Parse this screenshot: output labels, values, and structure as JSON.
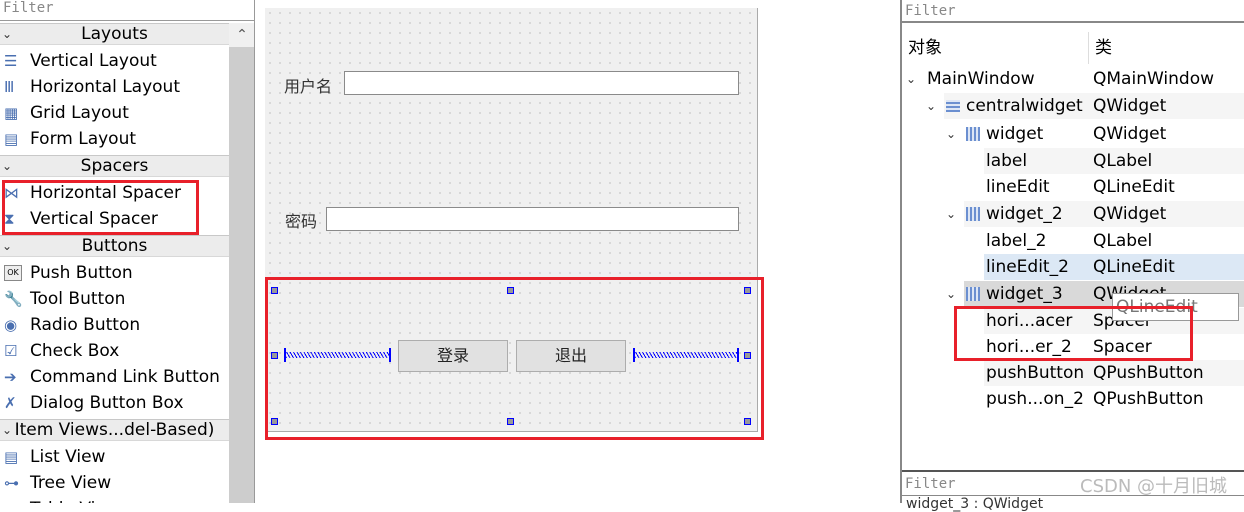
{
  "widget_box": {
    "filter_placeholder": "Filter",
    "categories": [
      {
        "label": "Layouts",
        "items": [
          {
            "label": "Vertical Layout",
            "icon": "vertical-layout-icon"
          },
          {
            "label": "Horizontal Layout",
            "icon": "horizontal-layout-icon"
          },
          {
            "label": "Grid Layout",
            "icon": "grid-layout-icon"
          },
          {
            "label": "Form Layout",
            "icon": "form-layout-icon"
          }
        ]
      },
      {
        "label": "Spacers",
        "items": [
          {
            "label": "Horizontal Spacer",
            "icon": "horizontal-spacer-icon"
          },
          {
            "label": "Vertical Spacer",
            "icon": "vertical-spacer-icon"
          }
        ]
      },
      {
        "label": "Buttons",
        "items": [
          {
            "label": "Push Button",
            "icon": "push-button-icon"
          },
          {
            "label": "Tool Button",
            "icon": "tool-button-icon"
          },
          {
            "label": "Radio Button",
            "icon": "radio-button-icon"
          },
          {
            "label": "Check Box",
            "icon": "check-box-icon"
          },
          {
            "label": "Command Link Button",
            "icon": "command-link-icon"
          },
          {
            "label": "Dialog Button Box",
            "icon": "dialog-button-box-icon"
          }
        ]
      },
      {
        "label": "Item Views...del-Based)",
        "items": [
          {
            "label": "List View",
            "icon": "list-view-icon"
          },
          {
            "label": "Tree View",
            "icon": "tree-view-icon"
          },
          {
            "label": "Table View",
            "icon": "table-view-icon"
          }
        ]
      }
    ]
  },
  "form": {
    "username_label": "用户名",
    "password_label": "密码",
    "login_button": "登录",
    "quit_button": "退出"
  },
  "object_inspector": {
    "filter_placeholder": "Filter",
    "col_object": "对象",
    "col_class": "类",
    "rows": [
      {
        "name": "MainWindow",
        "class": "QMainWindow"
      },
      {
        "name": "centralwidget",
        "class": "QWidget"
      },
      {
        "name": "widget",
        "class": "QWidget"
      },
      {
        "name": "label",
        "class": "QLabel"
      },
      {
        "name": "lineEdit",
        "class": "QLineEdit"
      },
      {
        "name": "widget_2",
        "class": "QWidget"
      },
      {
        "name": "label_2",
        "class": "QLabel"
      },
      {
        "name": "lineEdit_2",
        "class": "QLineEdit"
      },
      {
        "name": "widget_3",
        "class": "QWidget"
      },
      {
        "name": "hori...acer",
        "class": "Spacer"
      },
      {
        "name": "hori...er_2",
        "class": "Spacer"
      },
      {
        "name": "pushButton",
        "class": "QPushButton"
      },
      {
        "name": "push...on_2",
        "class": "QPushButton"
      }
    ],
    "tooltip": "QLineEdit"
  },
  "property_editor": {
    "filter_placeholder": "Filter",
    "cut_text": "widget_3 : QWidget"
  },
  "watermark": "CSDN @十月旧城",
  "colors": {
    "highlight_red": "#e8202a",
    "selection_blue": "#0000ff",
    "selected_row": "#dce8f5"
  }
}
